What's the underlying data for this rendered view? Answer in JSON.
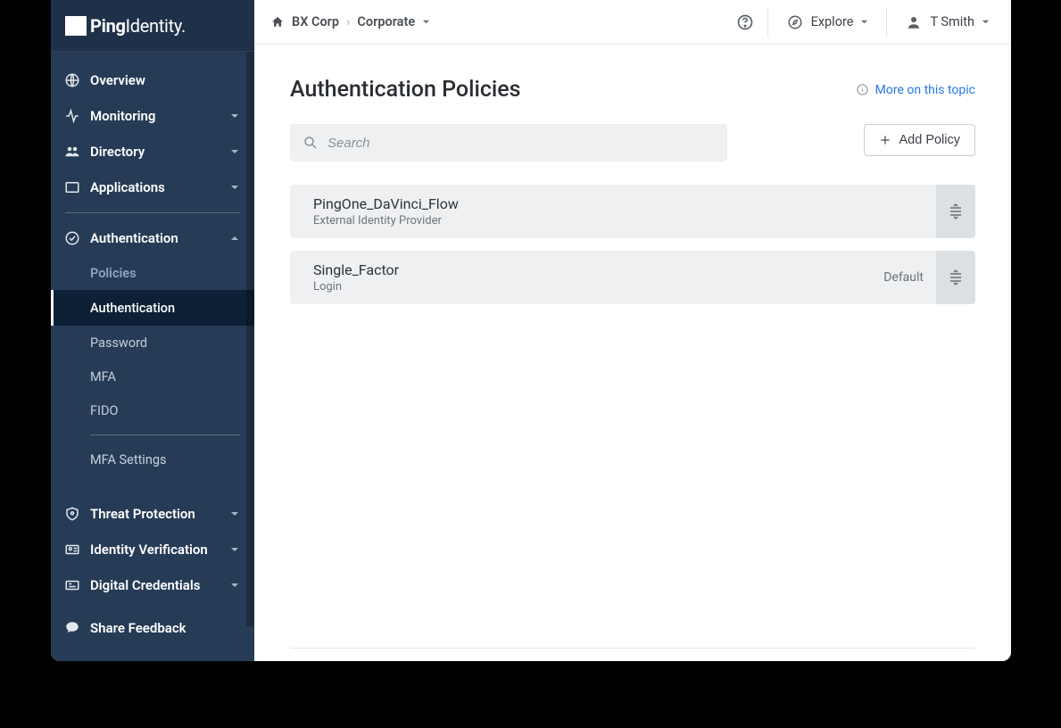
{
  "brand": {
    "prefix": "Ping",
    "suffix": "Identity."
  },
  "sidebar": {
    "overview": "Overview",
    "monitoring": "Monitoring",
    "directory": "Directory",
    "applications": "Applications",
    "authentication": "Authentication",
    "auth_sub": {
      "policies": "Policies",
      "authentication": "Authentication",
      "password": "Password",
      "mfa": "MFA",
      "fido": "FIDO",
      "mfa_settings": "MFA Settings"
    },
    "threat_protection": "Threat Protection",
    "identity_verification": "Identity Verification",
    "digital_credentials": "Digital Credentials",
    "share_feedback": "Share Feedback"
  },
  "topbar": {
    "breadcrumb_root": "BX Corp",
    "breadcrumb_env": "Corporate",
    "explore": "Explore",
    "user": "T Smith"
  },
  "page": {
    "title": "Authentication Policies",
    "more_link": "More on this topic",
    "search_placeholder": "Search",
    "add_button": "Add Policy",
    "default_label": "Default"
  },
  "policies": [
    {
      "name": "PingOne_DaVinci_Flow",
      "subtitle": "External Identity Provider",
      "default": false
    },
    {
      "name": "Single_Factor",
      "subtitle": "Login",
      "default": true
    }
  ]
}
